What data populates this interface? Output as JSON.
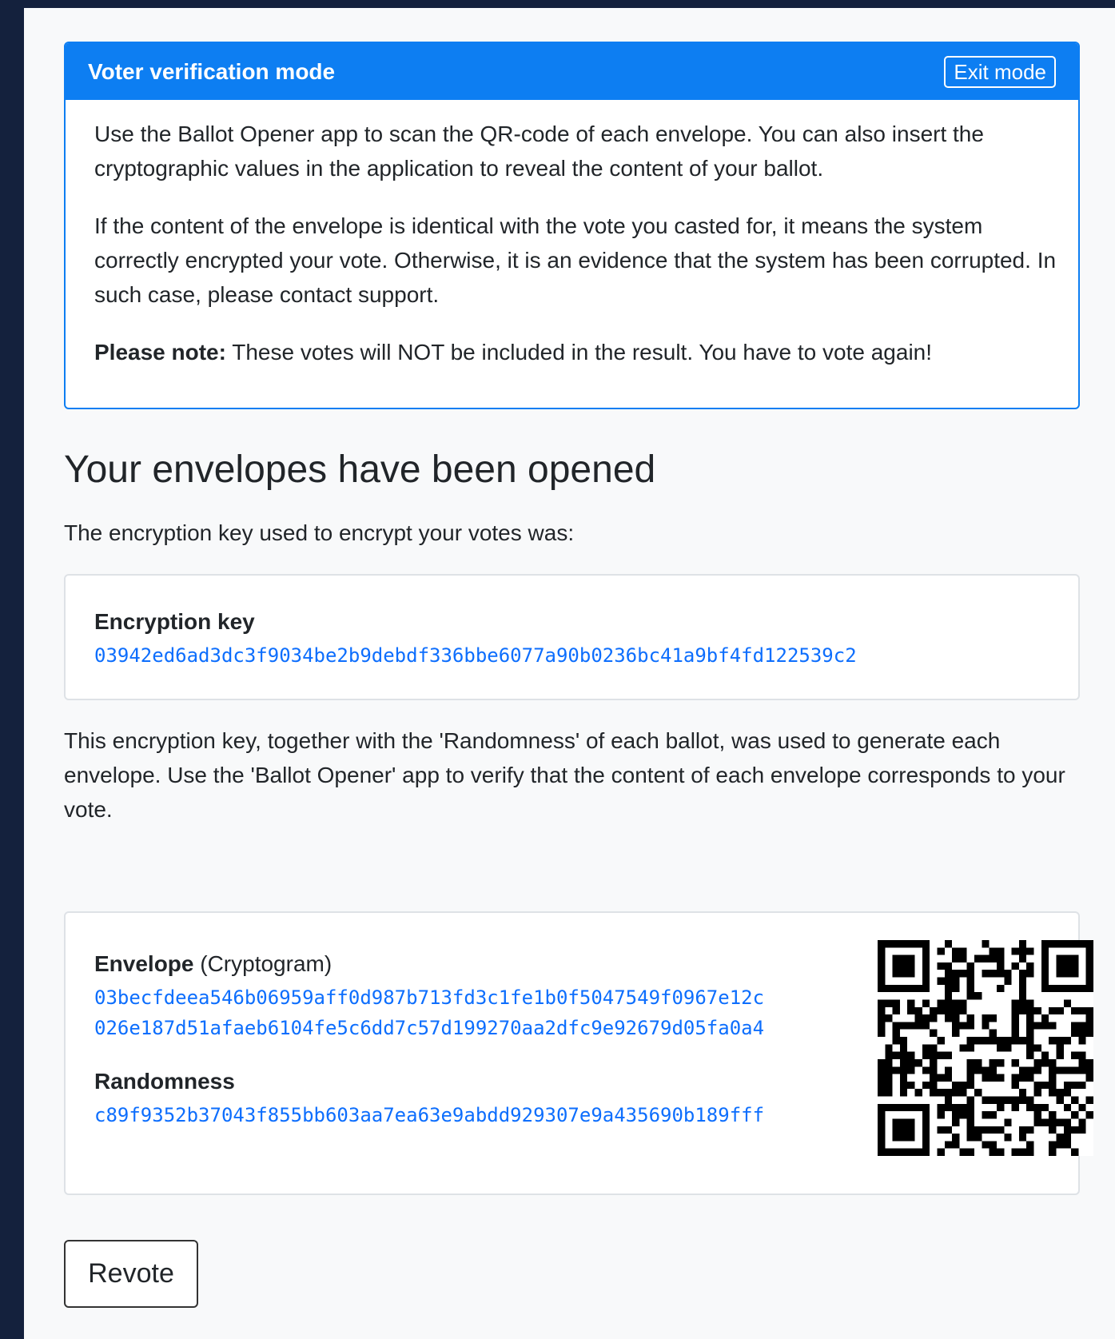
{
  "panel": {
    "title": "Voter verification mode",
    "exit_label": "Exit mode",
    "paragraph1": "Use the Ballot Opener app to scan the QR-code of each envelope. You can also insert the cryptographic values in the application to reveal the content of your ballot.",
    "paragraph2": "If the content of the envelope is identical with the vote you casted for, it means the system correctly encrypted your vote. Otherwise, it is an evidence that the system has been corrupted. In such case, please contact support.",
    "note_bold": "Please note:",
    "note_text": " These votes will NOT be included in the result. You have to vote again!"
  },
  "main": {
    "heading": "Your envelopes have been opened",
    "intro": "The encryption key used to encrypt your votes was:",
    "key_label": "Encryption key",
    "key_value": "03942ed6ad3dc3f9034be2b9debdf336bbe6077a90b0236bc41a9bf4fd122539c2",
    "explanation": "This encryption key, together with the 'Randomness' of each ballot, was used to generate each envelope. Use the 'Ballot Opener' app to verify that the content of each envelope corresponds to your vote."
  },
  "envelope": {
    "label": "Envelope",
    "label_suffix": " (Cryptogram)",
    "line1": "03becfdeea546b06959aff0d987b713fd3c1fe1b0f5047549f0967e12c",
    "line2": "026e187d51afaeb6104fe5c6dd7c57d199270aa2dfc9e92679d05fa0a4",
    "randomness_label": "Randomness",
    "randomness_value": "c89f9352b37043f855bb603aa7ea63e9abdd929307e9a435690b189fff"
  },
  "actions": {
    "revote_label": "Revote"
  }
}
